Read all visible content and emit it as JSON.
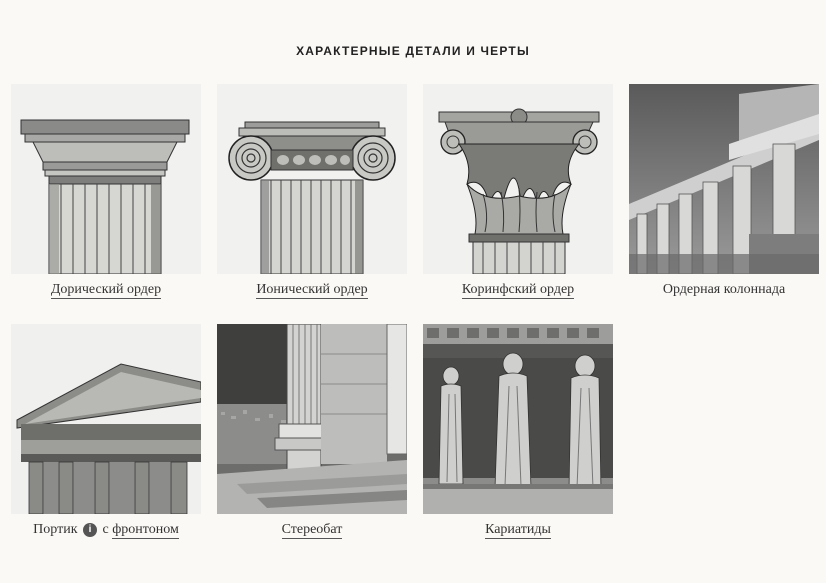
{
  "section": {
    "title": "ХАРАКТЕРНЫЕ ДЕТАЛИ И ЧЕРТЫ"
  },
  "cards": [
    {
      "label": "Дорический ордер",
      "link": true
    },
    {
      "label": "Ионический ордер",
      "link": true
    },
    {
      "label": "Коринфский ордер",
      "link": true
    },
    {
      "label": "Ордерная колоннада",
      "link": false
    },
    {
      "label_prefix": "Портик",
      "info_icon": "info-icon",
      "label_middle": "с",
      "label_link": "фронтоном"
    },
    {
      "label": "Стереобат",
      "link": true
    },
    {
      "label": "Кариатиды",
      "link": true
    }
  ]
}
